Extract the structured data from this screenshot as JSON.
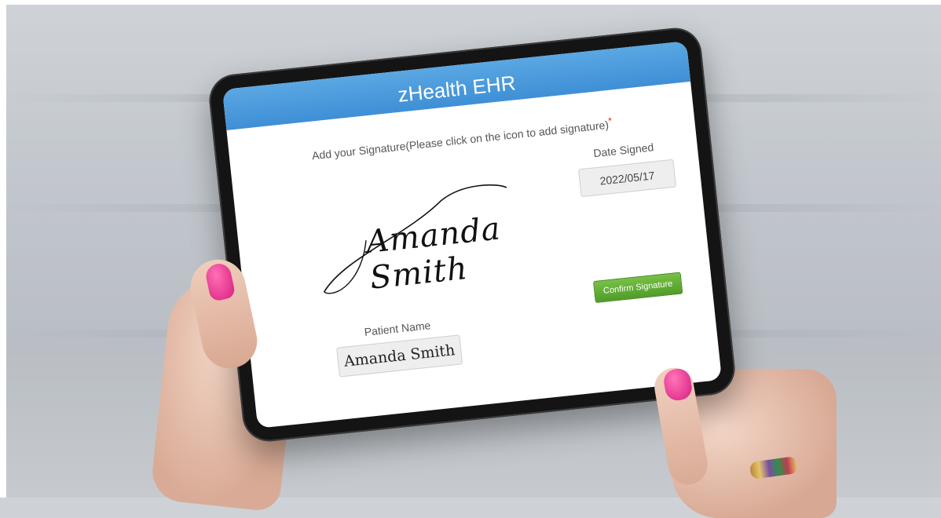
{
  "app": {
    "title": "zHealth EHR"
  },
  "signature": {
    "instruction": "Add your Signature(Please click on the icon to add signature)",
    "required_marker": "*",
    "signed_name": "Amanda Smith"
  },
  "date": {
    "label": "Date Signed",
    "value": "2022/05/17"
  },
  "confirm": {
    "label": "Confirm Signature"
  },
  "patient": {
    "label": "Patient Name",
    "value": "Amanda Smith"
  },
  "colors": {
    "header": "#4a9ade",
    "confirm_button": "#5fad34",
    "required_marker": "#e02020",
    "nail_polish": "#e8368f"
  },
  "icons": [
    "pen-signature-icon"
  ]
}
